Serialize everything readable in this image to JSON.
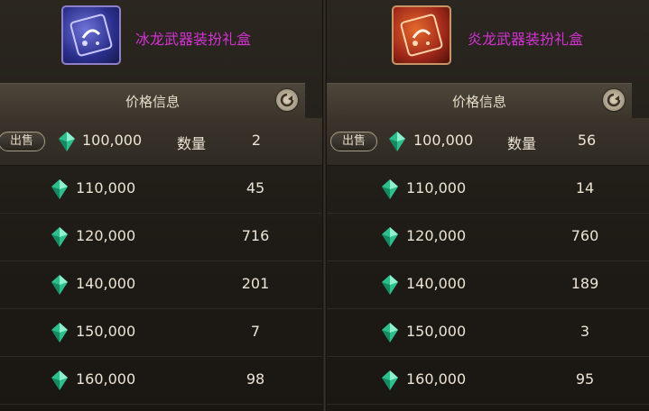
{
  "panels": [
    {
      "item_name": "冰龙武器装扮礼盒",
      "item_icon": "ice-dragon-giftbox-icon",
      "price_header": "价格信息",
      "sell_label": "出售",
      "qty_label": "数量",
      "listings": [
        {
          "price": "100,000",
          "qty": "2"
        },
        {
          "price": "110,000",
          "qty": "45"
        },
        {
          "price": "120,000",
          "qty": "716"
        },
        {
          "price": "140,000",
          "qty": "201"
        },
        {
          "price": "150,000",
          "qty": "7"
        },
        {
          "price": "160,000",
          "qty": "98"
        }
      ]
    },
    {
      "item_name": "炎龙武器装扮礼盒",
      "item_icon": "fire-dragon-giftbox-icon",
      "price_header": "价格信息",
      "sell_label": "出售",
      "qty_label": "数量",
      "listings": [
        {
          "price": "100,000",
          "qty": "56"
        },
        {
          "price": "110,000",
          "qty": "14"
        },
        {
          "price": "120,000",
          "qty": "760"
        },
        {
          "price": "140,000",
          "qty": "189"
        },
        {
          "price": "150,000",
          "qty": "3"
        },
        {
          "price": "160,000",
          "qty": "95"
        }
      ]
    }
  ],
  "colors": {
    "item_name": "#d233d2",
    "text": "#ece4d4",
    "gem": "#2fbf8f"
  }
}
